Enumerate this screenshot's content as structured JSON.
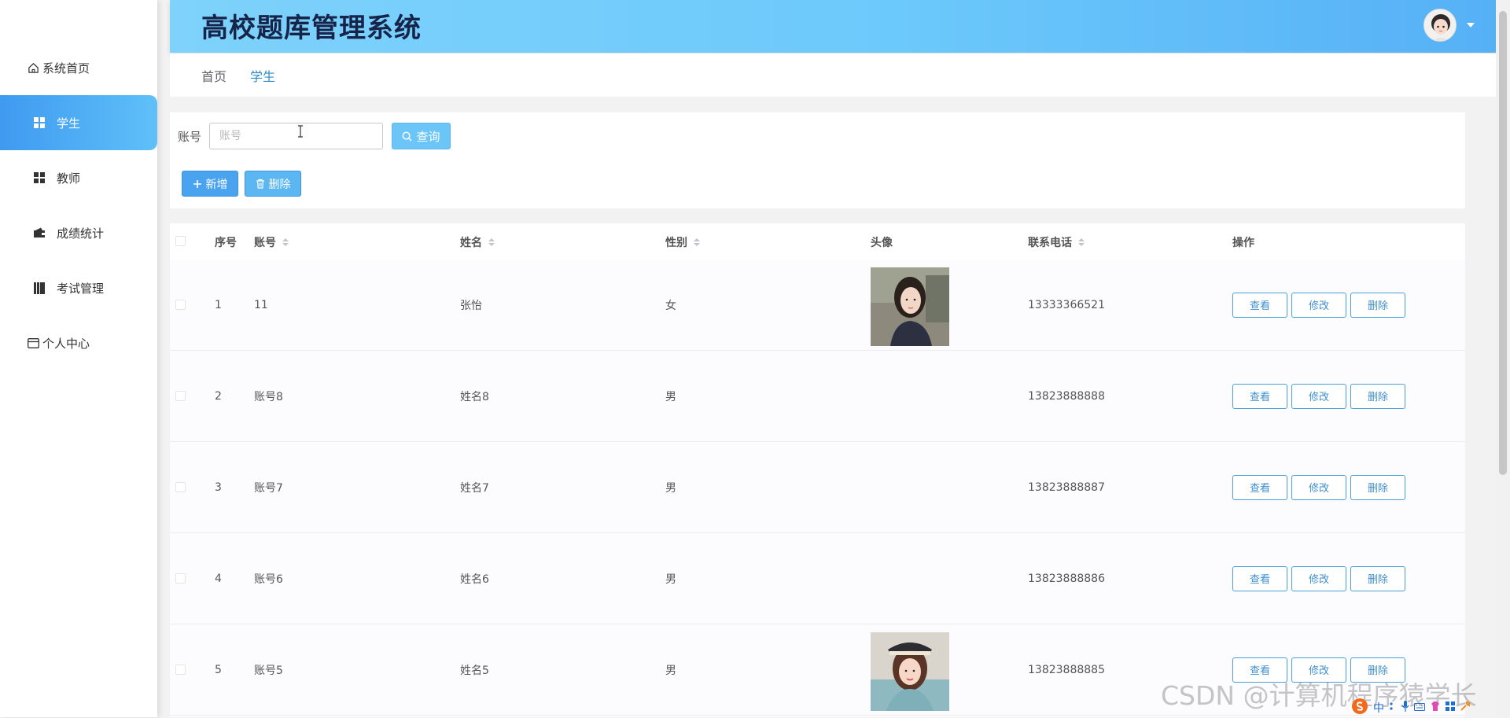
{
  "app": {
    "title": "高校题库管理系统"
  },
  "sidebar": {
    "items": [
      {
        "label": "系统首页",
        "icon": "home-icon"
      },
      {
        "label": "学生",
        "icon": "grid-icon",
        "active": true
      },
      {
        "label": "教师",
        "icon": "grid-icon"
      },
      {
        "label": "成绩统计",
        "icon": "wallet-icon"
      },
      {
        "label": "考试管理",
        "icon": "book-icon"
      },
      {
        "label": "个人中心",
        "icon": "card-icon"
      }
    ]
  },
  "breadcrumb": {
    "home": "首页",
    "current": "学生"
  },
  "search": {
    "label": "账号",
    "placeholder": "账号",
    "value": "",
    "query_label": "查询",
    "add_label": "新增",
    "delete_label": "删除"
  },
  "table": {
    "headers": {
      "index": "序号",
      "account": "账号",
      "name": "姓名",
      "gender": "性别",
      "avatar": "头像",
      "phone": "联系电话",
      "actions": "操作"
    },
    "action_labels": {
      "view": "查看",
      "edit": "修改",
      "delete": "删除"
    },
    "rows": [
      {
        "index": "1",
        "account": "11",
        "name": "张怡",
        "gender": "女",
        "phone": "13333366521",
        "has_photo": true
      },
      {
        "index": "2",
        "account": "账号8",
        "name": "姓名8",
        "gender": "男",
        "phone": "13823888888",
        "has_photo": false
      },
      {
        "index": "3",
        "account": "账号7",
        "name": "姓名7",
        "gender": "男",
        "phone": "13823888887",
        "has_photo": false
      },
      {
        "index": "4",
        "account": "账号6",
        "name": "姓名6",
        "gender": "男",
        "phone": "13823888886",
        "has_photo": false
      },
      {
        "index": "5",
        "account": "账号5",
        "name": "姓名5",
        "gender": "男",
        "phone": "13823888885",
        "has_photo": true
      }
    ]
  },
  "watermark": "CSDN @计算机程序猿学长",
  "ime": {
    "lang": "中"
  },
  "colors": {
    "accent": "#409eff",
    "header_gradient_start": "#7ed2fb",
    "header_gradient_end": "#56b0f6",
    "active_menu": "#4aa8f2",
    "outline_button": "#4a9fd8"
  }
}
